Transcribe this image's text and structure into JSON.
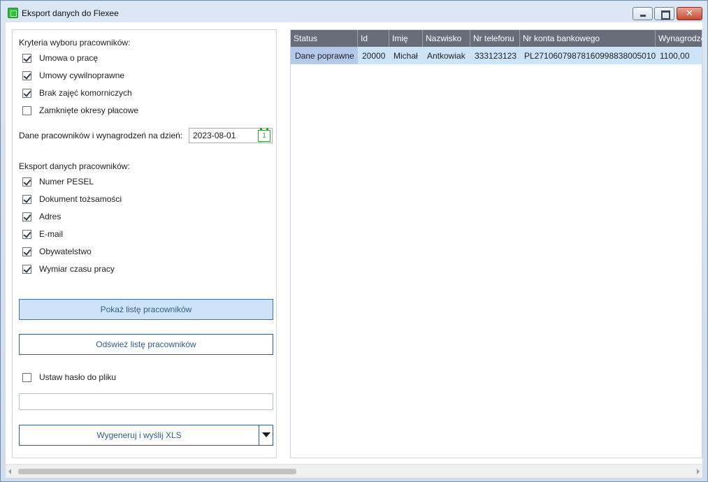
{
  "window": {
    "title": "Eksport danych do Flexee"
  },
  "criteria": {
    "heading": "Kryteria wyboru pracowników:",
    "items": [
      {
        "label": "Umowa o pracę",
        "checked": true
      },
      {
        "label": "Umowy cywilnoprawne",
        "checked": true
      },
      {
        "label": "Brak zajęć komorniczych",
        "checked": true
      },
      {
        "label": "Zamknięte okresy płacowe",
        "checked": false
      }
    ]
  },
  "date": {
    "label": "Dane pracowników i wynagrodzeń na dzień:",
    "value": "2023-08-01",
    "calendar_day": "1"
  },
  "export": {
    "heading": "Eksport danych pracowników:",
    "items": [
      {
        "label": "Numer PESEL",
        "checked": true
      },
      {
        "label": "Dokument tożsamości",
        "checked": true
      },
      {
        "label": "Adres",
        "checked": true
      },
      {
        "label": "E-mail",
        "checked": true
      },
      {
        "label": "Obywatelstwo",
        "checked": true
      },
      {
        "label": "Wymiar czasu pracy",
        "checked": true
      }
    ]
  },
  "buttons": {
    "show_list": "Pokaż listę pracowników",
    "refresh_list": "Odśwież listę pracowników",
    "generate": "Wygeneruj i wyślij XLS"
  },
  "password": {
    "label": "Ustaw hasło do pliku",
    "checked": false,
    "value": ""
  },
  "table": {
    "columns": [
      "Status",
      "Id",
      "Imię",
      "Nazwisko",
      "Nr telefonu",
      "Nr konta bankowego",
      "Wynagrodzenie"
    ],
    "rows": [
      [
        "Dane poprawne",
        "20000",
        "Michał",
        "Antkowiak",
        "333123123",
        "PL27106079878160998838005010",
        "1100,00"
      ]
    ]
  },
  "colors": {
    "header_bg": "#686e79",
    "row_selected": "#cde4f8",
    "accent": "#2f5d8c"
  }
}
